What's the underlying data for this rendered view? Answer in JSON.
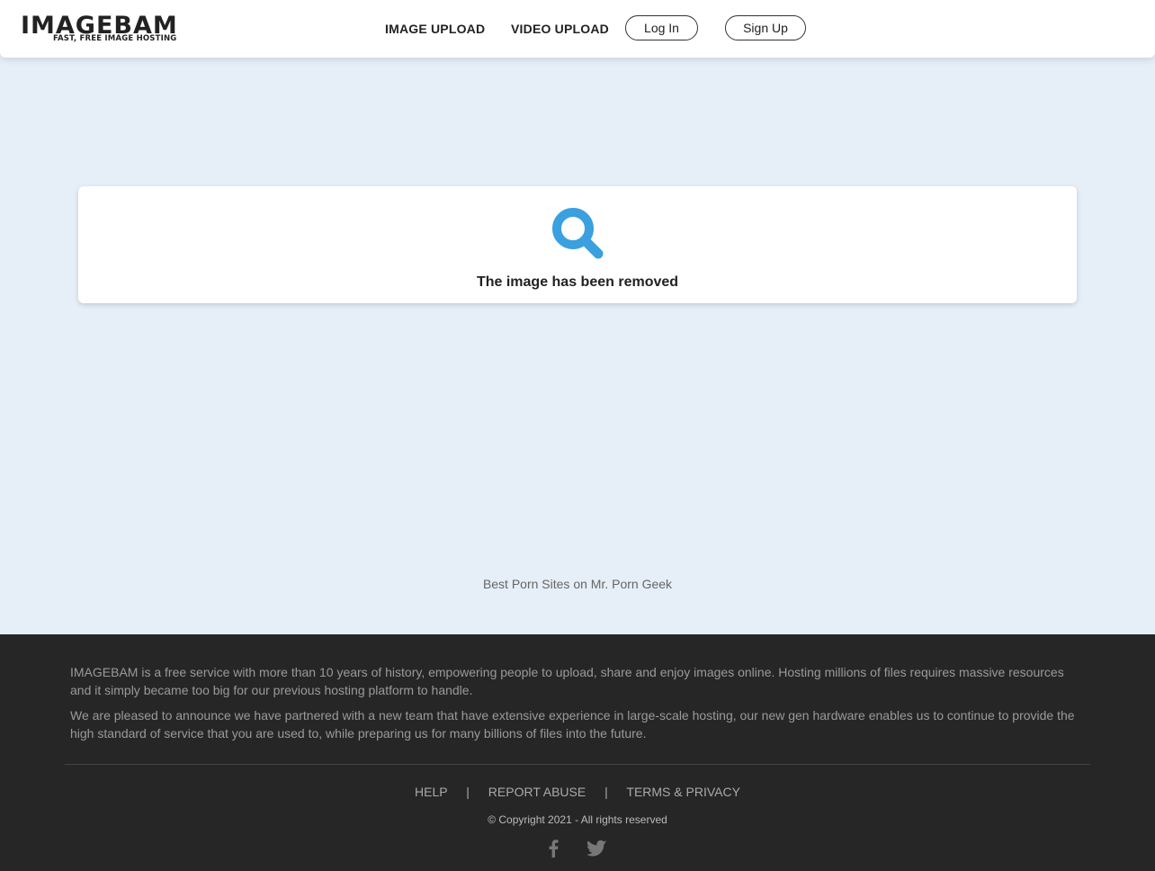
{
  "header": {
    "logo": {
      "title": "IMAGEBAM",
      "tagline": "FAST, FREE IMAGE HOSTING"
    },
    "nav": {
      "image_upload": "IMAGE UPLOAD",
      "video_upload": "VIDEO UPLOAD",
      "login": "Log In",
      "signup": "Sign Up"
    }
  },
  "main": {
    "icon": "search-icon",
    "message": "The image has been removed",
    "promo_link": "Best Porn Sites on Mr. Porn Geek"
  },
  "footer": {
    "paragraph1": "IMAGEBAM is a free service with more than 10 years of history, empowering people to upload, share and enjoy images online. Hosting millions of files requires massive resources and it simply became too big for our previous hosting platform to handle.",
    "paragraph2": "We are pleased to announce we have partnered with a new team that have extensive experience in large-scale hosting, our new gen hardware enables us to continue to provide the high standard of service that you are used to, while preparing us for many billions of files into the future.",
    "links": {
      "help": "HELP",
      "report": "REPORT ABUSE",
      "terms": "TERMS & PRIVACY",
      "separator": "|"
    },
    "copyright": "© Copyright 2021 - All rights reserved",
    "social": [
      "facebook-icon",
      "twitter-icon"
    ]
  },
  "colors": {
    "accent": "#3aa0e0",
    "page_bg": "#e6eef7",
    "footer_bg": "#262626"
  }
}
